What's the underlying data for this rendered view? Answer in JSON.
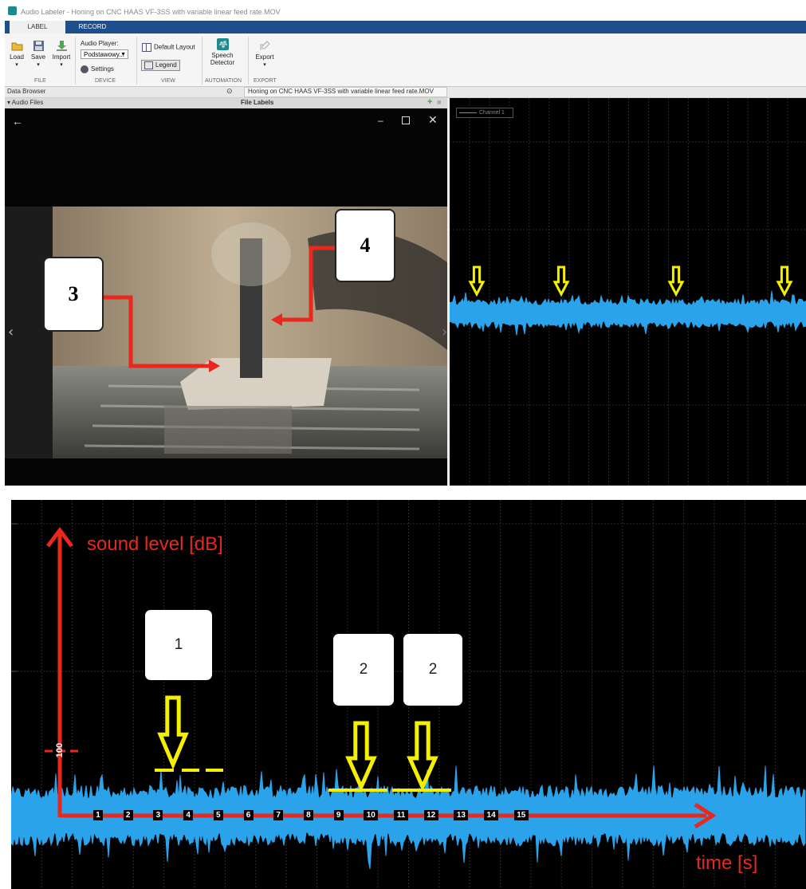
{
  "window": {
    "title": "Audio Labeler - Honing on CNC HAAS VF-3SS with variable linear feed rate.MOV"
  },
  "ribbon": {
    "tabs": [
      "LABEL",
      "RECORD"
    ],
    "file": {
      "load": "Load",
      "save": "Save",
      "import": "Import",
      "group": "FILE"
    },
    "device": {
      "player_label": "Audio Player:",
      "player_value": "Podstawowy...",
      "settings": "Settings",
      "group": "DEVICE"
    },
    "view": {
      "default_layout": "Default Layout",
      "legend": "Legend",
      "group": "VIEW"
    },
    "automation": {
      "speech_detector": "Speech Detector",
      "group": "AUTOMATION"
    },
    "export": {
      "export": "Export",
      "group": "EXPORT"
    }
  },
  "panels": {
    "data_browser": "Data Browser",
    "audio_files": "Audio Files",
    "file_tab": "Honing on CNC HAAS VF-3SS with variable linear feed rate.MOV",
    "file_labels": "File Labels"
  },
  "legend": {
    "channel": "Channel 1"
  },
  "annotations_top": {
    "box3": "3",
    "box4": "4"
  },
  "annotations_bottom": {
    "box1": "1",
    "box2a": "2",
    "box2b": "2",
    "y_axis_label": "sound level [dB]",
    "x_axis_label": "time [s]",
    "y_tick": "100",
    "x_ticks": [
      "1",
      "2",
      "3",
      "4",
      "5",
      "6",
      "7",
      "8",
      "9",
      "10",
      "11",
      "12",
      "13",
      "14",
      "15"
    ]
  },
  "colors": {
    "waveform": "#2aa3ea",
    "annotation_arrow": "#e8281c",
    "marker_arrow": "#f4f000",
    "ribbon_tabstrip": "#1e4f8c"
  }
}
